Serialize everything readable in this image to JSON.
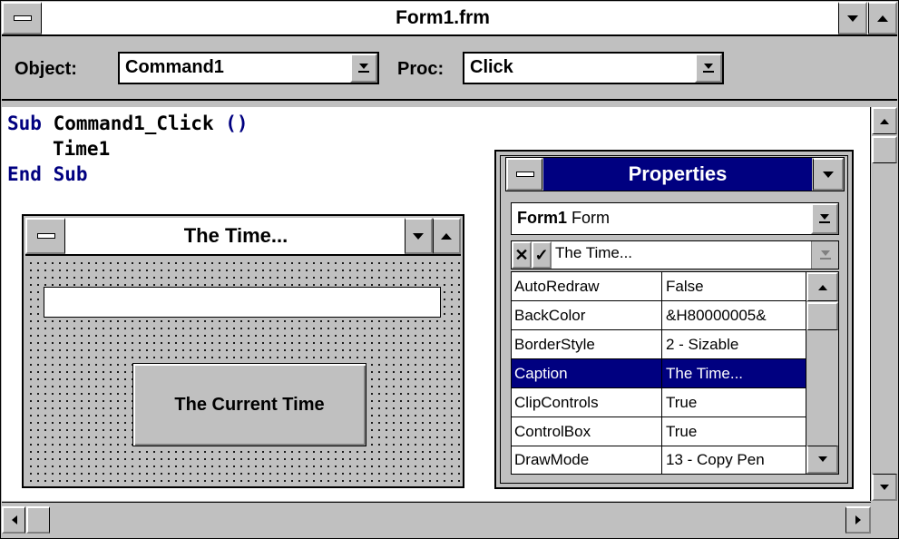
{
  "window": {
    "title": "Form1.frm"
  },
  "toolbar": {
    "object_label": "Object:",
    "object_value": "Command1",
    "proc_label": "Proc:",
    "proc_value": "Click"
  },
  "code": {
    "line1_kw": "Sub",
    "line1_name": "Command1_Click",
    "line1_paren": "()",
    "line2": "Time1",
    "line3_kw1": "End",
    "line3_kw2": "Sub"
  },
  "form_window": {
    "title": "The Time...",
    "button_label": "The Current Time"
  },
  "properties": {
    "title": "Properties",
    "object_name": "Form1",
    "object_type": "Form",
    "edit_value": "The Time...",
    "rows": [
      {
        "name": "AutoRedraw",
        "value": "False"
      },
      {
        "name": "BackColor",
        "value": "&H80000005&"
      },
      {
        "name": "BorderStyle",
        "value": "2 - Sizable"
      },
      {
        "name": "Caption",
        "value": "The Time..."
      },
      {
        "name": "ClipControls",
        "value": "True"
      },
      {
        "name": "ControlBox",
        "value": "True"
      },
      {
        "name": "DrawMode",
        "value": "13 - Copy Pen"
      }
    ],
    "selected_row": "Caption"
  },
  "colors": {
    "title_active": "#000080",
    "code_keyword": "#000080",
    "selection": "#000080",
    "face": "#c0c0c0"
  }
}
